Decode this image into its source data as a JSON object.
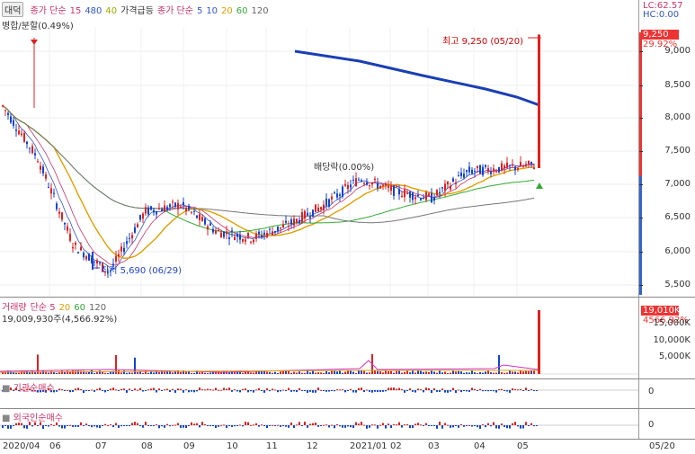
{
  "legend": {
    "period_btn": "대덕",
    "items": [
      {
        "text": "종가 단순",
        "color": "#cc3366"
      },
      {
        "text": "15",
        "color": "#cc3366"
      },
      {
        "text": "480",
        "color": "#3355cc"
      },
      {
        "text": "40",
        "color": "#99aa00"
      },
      {
        "text": "가격급등",
        "color": "#333333"
      },
      {
        "text": "종가 단순",
        "color": "#cc3366"
      },
      {
        "text": "5",
        "color": "#3355cc"
      },
      {
        "text": "10",
        "color": "#3355cc"
      },
      {
        "text": "20",
        "color": "#e0a000"
      },
      {
        "text": "60",
        "color": "#33aa33"
      },
      {
        "text": "120",
        "color": "#666666"
      }
    ],
    "split_label": "병합/분할(0.49%)"
  },
  "price_axis": {
    "ticks": [
      "9,000",
      "8,500",
      "8,000",
      "7,500",
      "7,000",
      "6,500",
      "6,000",
      "5,500"
    ],
    "lc": "LC:62.57",
    "hc": "HC:0.00",
    "current_price": "9,250",
    "current_pct": "29.92%"
  },
  "annotations": {
    "high": "최고 9,250 (05/20)",
    "low": "최저 5,690 (06/29)",
    "dividend": "배당락(0.00%)"
  },
  "volume": {
    "legend": [
      {
        "text": "거래량",
        "color": "#cc3366"
      },
      {
        "text": "단순 5",
        "color": "#cc3366"
      },
      {
        "text": "20",
        "color": "#e0a000"
      },
      {
        "text": "60",
        "color": "#33aa33"
      },
      {
        "text": "120",
        "color": "#666666"
      }
    ],
    "current_text": "19,009,930주(4,566.92%)",
    "axis_ticks": [
      "15,000K",
      "10,000K",
      "5,000K"
    ],
    "current_tag": "19,010K",
    "current_pct": "4566.92%"
  },
  "institution": {
    "label": "기관순매수",
    "zero": "0"
  },
  "foreign": {
    "label": "외국인순매수",
    "zero": "0"
  },
  "x_axis": {
    "labels": [
      "2020/04",
      "06",
      "07",
      "08",
      "09",
      "10",
      "11",
      "12",
      "2021/01",
      "02",
      "03",
      "04",
      "05"
    ],
    "right_label": "05/20"
  },
  "chart_data": {
    "type": "candlestick",
    "title": "대덕",
    "x_range": [
      "2020/04",
      "2021/05/20"
    ],
    "ylim": [
      5400,
      9400
    ],
    "price_path": [
      {
        "date": "2020/04",
        "close": 8200
      },
      {
        "date": "2020/05",
        "close": 7400
      },
      {
        "date": "2020/06",
        "close": 6100
      },
      {
        "date": "2020/06/29",
        "close": 5690
      },
      {
        "date": "2020/07",
        "close": 6600
      },
      {
        "date": "2020/08",
        "close": 6700
      },
      {
        "date": "2020/09",
        "close": 6300
      },
      {
        "date": "2020/10",
        "close": 6200
      },
      {
        "date": "2020/11",
        "close": 6400
      },
      {
        "date": "2020/12",
        "close": 6700
      },
      {
        "date": "2021/01",
        "close": 7100
      },
      {
        "date": "2021/02",
        "close": 6900
      },
      {
        "date": "2021/03",
        "close": 6800
      },
      {
        "date": "2021/04",
        "close": 7200
      },
      {
        "date": "2021/05",
        "close": 7300
      },
      {
        "date": "2021/05/20",
        "close": 9250
      }
    ],
    "high": 9250,
    "low": 5690
  }
}
